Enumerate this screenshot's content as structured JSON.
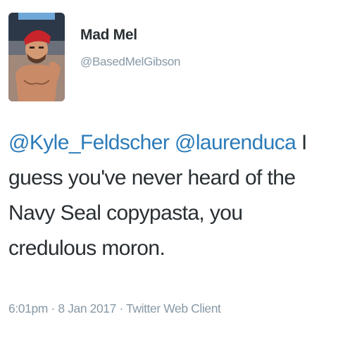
{
  "user": {
    "display_name": "Mad Mel",
    "handle": "@BasedMelGibson",
    "avatar_icon": "profile-photo"
  },
  "tweet": {
    "mention_1": "@Kyle_Feldscher",
    "mention_2": "@laurenduca",
    "line_1_tail": "I",
    "line_2": "guess you've never heard of the",
    "line_3": "Navy Seal copypasta, you",
    "line_4": "credulous moron."
  },
  "meta": {
    "time": "6:01pm",
    "separator": "·",
    "date": "8 Jan 2017",
    "source": "Twitter Web Client"
  },
  "colors": {
    "link": "#2b7bb9",
    "text": "#292f33",
    "muted": "#8899a6"
  }
}
